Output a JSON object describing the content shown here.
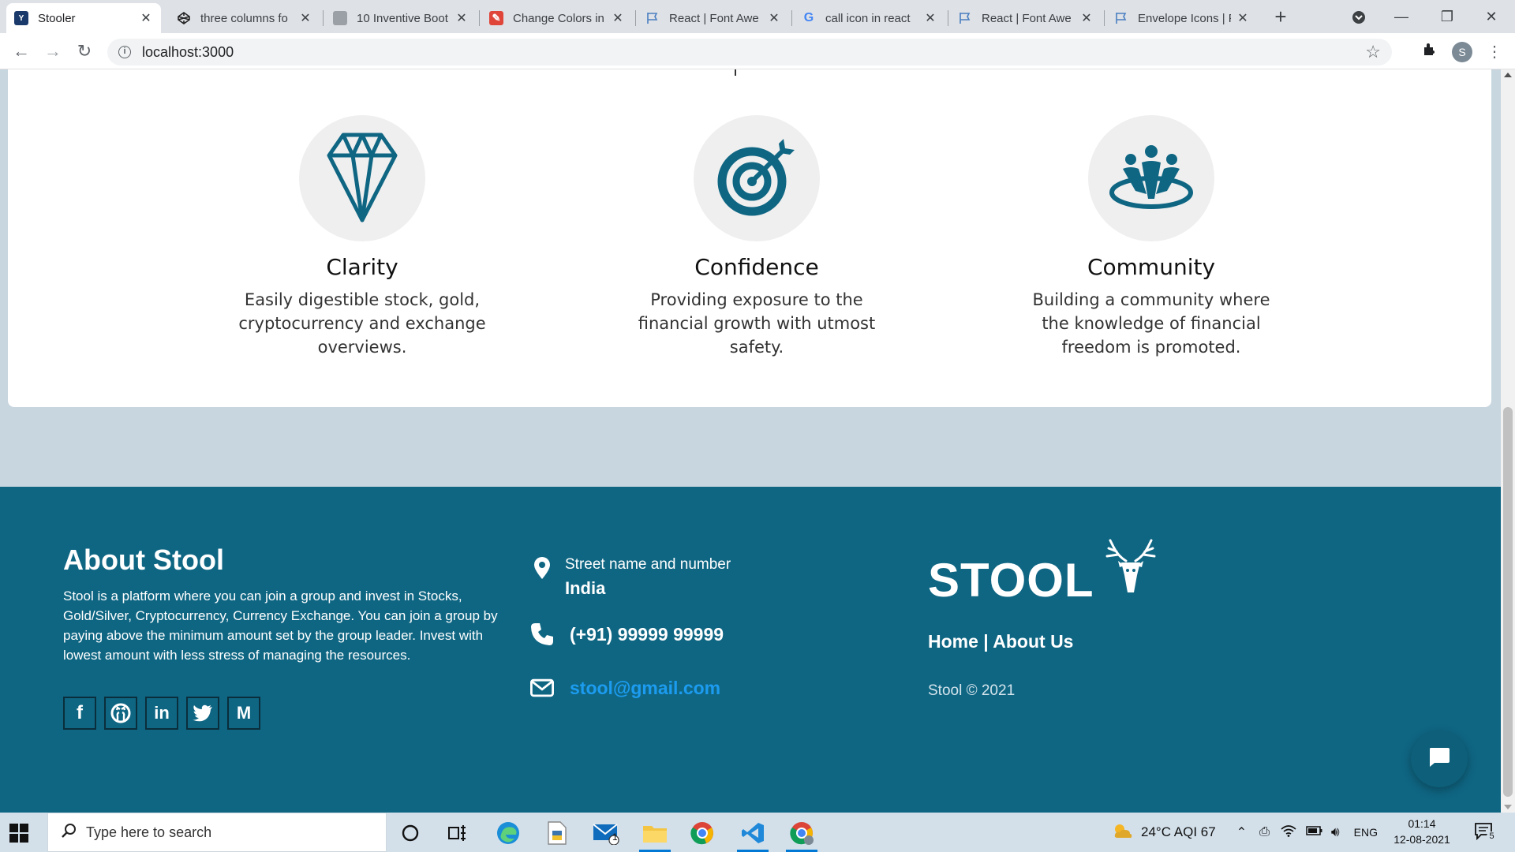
{
  "browser": {
    "tabs": [
      {
        "label": "Stooler",
        "favicon": "stooler-favicon",
        "active": true
      },
      {
        "label": "three columns fo",
        "favicon": "codepen-favicon"
      },
      {
        "label": "10 Inventive Boot",
        "favicon": "doc-favicon"
      },
      {
        "label": "Change Colors in",
        "favicon": "tool-favicon"
      },
      {
        "label": "React | Font Awe",
        "favicon": "flag-favicon"
      },
      {
        "label": "call icon in react",
        "favicon": "google-favicon"
      },
      {
        "label": "React | Font Awe",
        "favicon": "flag-favicon"
      },
      {
        "label": "Envelope Icons | F",
        "favicon": "flag-favicon"
      }
    ],
    "url": "localhost:3000",
    "profile_initial": "S"
  },
  "features": [
    {
      "title": "Clarity",
      "text": "Easily digestible stock, gold, cryptocurrency and exchange overviews.",
      "icon": "diamond-icon"
    },
    {
      "title": "Confidence",
      "text": "Providing exposure to the financial growth with utmost safety.",
      "icon": "target-icon"
    },
    {
      "title": "Community",
      "text": "Building a community where the knowledge of financial freedom is promoted.",
      "icon": "community-icon"
    }
  ],
  "footer": {
    "about_title": "About Stool",
    "about_text": "Stool is a platform where you can join a group and invest in Stocks, Gold/Silver, Cryptocurrency, Currency Exchange. You can join a group by paying above the minimum amount set by the group leader. Invest with lowest amount with less stress of managing the resources.",
    "socials": [
      "facebook-icon",
      "github-icon",
      "linkedin-icon",
      "twitter-icon",
      "medium-icon"
    ],
    "street": "Street name and number",
    "country": "India",
    "phone": "(+91) 99999 99999",
    "email": "stool@gmail.com",
    "brand": "STOOL",
    "links": "Home | About Us",
    "copyright": "Stool © 2021"
  },
  "taskbar": {
    "search_placeholder": "Type here to search",
    "weather": "24°C  AQI 67",
    "language": "ENG",
    "time": "01:14",
    "date": "12-08-2021",
    "notification_count": "5",
    "mail_badge": "1"
  },
  "colors": {
    "accent": "#0f6683",
    "link": "#1c9cf0",
    "page_bg": "#c8d6e0"
  }
}
